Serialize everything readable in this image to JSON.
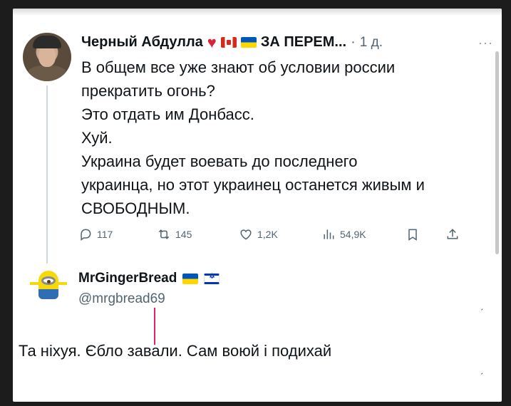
{
  "tweet": {
    "author": "Черный Абдулла",
    "name_suffix": "ЗА ПЕРЕМ...",
    "separator": "·",
    "time": "1 д.",
    "more": "···",
    "lines": [
      "В общем все уже знают об условии россии",
      "прекратить огонь?",
      "Это отдать им Донбасс.",
      "Хуй.",
      "Украина будет воевать до последнего",
      "украинца, но этот украинец останется живым и",
      "СВОБОДНЫМ."
    ],
    "actions": {
      "replies": "117",
      "retweets": "145",
      "likes": "1,2K",
      "views": "54,9K"
    }
  },
  "reply": {
    "name": "MrGingerBread",
    "handle": "@mrgbread69",
    "text": "Та ніхуя. Єбло завали. Сам воюй і подихай"
  },
  "icons": {
    "heart": "red-heart-emoji",
    "flag_canada": "canada-flag",
    "flag_ukraine": "ukraine-flag",
    "flag_israel": "israel-flag",
    "reply": "reply-icon",
    "retweet": "retweet-icon",
    "like": "like-icon",
    "views": "views-icon",
    "bookmark": "bookmark-icon",
    "share": "share-icon"
  },
  "colors": {
    "text": "#0f1419",
    "secondary": "#536471",
    "heart": "#d9233c",
    "cursor": "#e0245e"
  }
}
